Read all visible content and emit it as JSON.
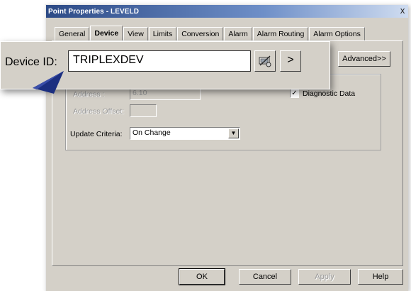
{
  "window": {
    "title": "Point Properties - LEVELD",
    "close_glyph": "x"
  },
  "tabs": [
    {
      "label": "General",
      "active": false
    },
    {
      "label": "Device",
      "active": true
    },
    {
      "label": "View",
      "active": false
    },
    {
      "label": "Limits",
      "active": false
    },
    {
      "label": "Conversion",
      "active": false
    },
    {
      "label": "Alarm",
      "active": false
    },
    {
      "label": "Alarm Routing",
      "active": false
    },
    {
      "label": "Alarm Options",
      "active": false
    }
  ],
  "device_tab": {
    "advanced_button": "Advanced>>",
    "address_label": "Address :",
    "address_value": "6.10",
    "diagnostic_label": "Diagnostic Data",
    "diagnostic_checked": true,
    "address_offset_label": "Address Offset:",
    "address_offset_value": "",
    "update_criteria_label": "Update Criteria:",
    "update_criteria_value": "On Change"
  },
  "callout": {
    "device_id_label": "Device ID:",
    "device_id_value": "TRIPLEXDEV",
    "browse_icon": "device-browse-icon",
    "arrow_label": ">"
  },
  "footer": {
    "ok": "OK",
    "cancel": "Cancel",
    "apply": "Apply",
    "help": "Help"
  },
  "colors": {
    "dialog_bg": "#d4d0c8",
    "titlebar_start": "#2c4a86",
    "titlebar_end": "#cfdcf0",
    "pointer": "#1c2f80"
  }
}
